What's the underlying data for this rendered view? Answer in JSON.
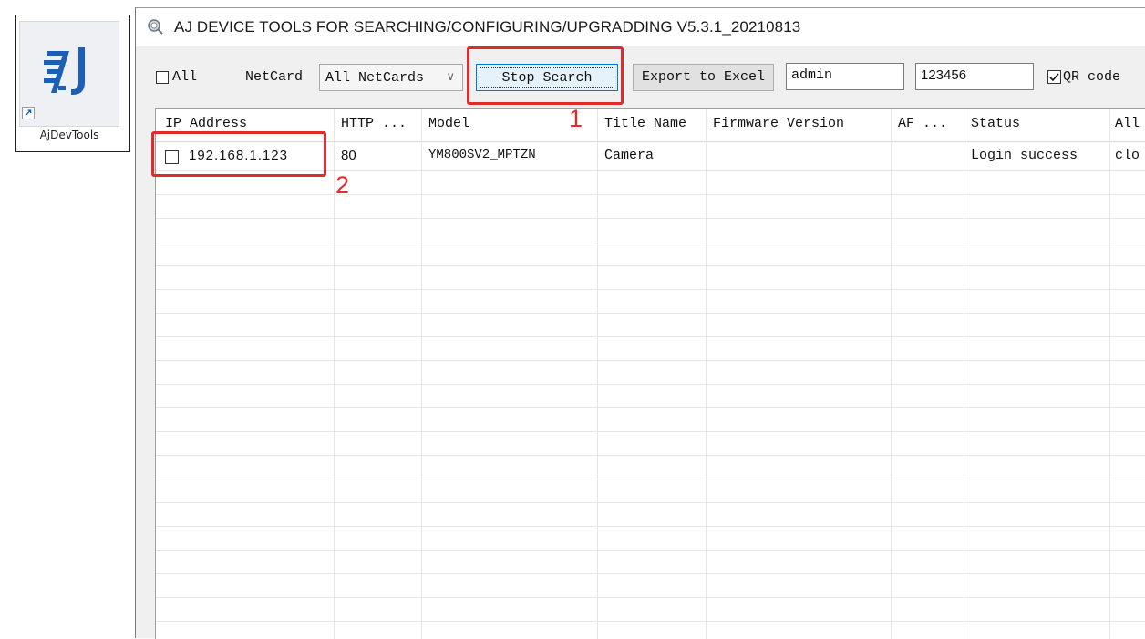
{
  "desktop": {
    "shortcut_label": "AjDevTools",
    "shortcut_logo_text": "AJ"
  },
  "window": {
    "title": "AJ DEVICE TOOLS FOR SEARCHING/CONFIGURING/UPGRADDING V5.3.1_20210813"
  },
  "toolbar": {
    "all_label": "All",
    "all_checked": false,
    "netcard_label": "NetCard",
    "netcard_value": "All NetCards",
    "stop_search_label": "Stop Search",
    "export_label": "Export to Excel",
    "username_value": "admin",
    "password_value": "123456",
    "qr_label": "QR code",
    "qr_checked": true
  },
  "table": {
    "headers": [
      "IP Address",
      "HTTP ...",
      "Model",
      "Title Name",
      "Firmware Version",
      "AF ...",
      "Status",
      "All"
    ],
    "rows": [
      {
        "checked": false,
        "ip": "192.168.1.123",
        "http": "80",
        "model": "YM800SV2_MPTZN",
        "title_name": "Camera",
        "firmware": "",
        "af": "",
        "status": "Login success",
        "all": "clo"
      }
    ]
  },
  "annotations": {
    "label_1": "1",
    "label_2": "2"
  },
  "colors": {
    "annotation_red": "#e02b2b",
    "logo_blue": "#1d5fb5",
    "grid_line": "#e6e6e6"
  }
}
